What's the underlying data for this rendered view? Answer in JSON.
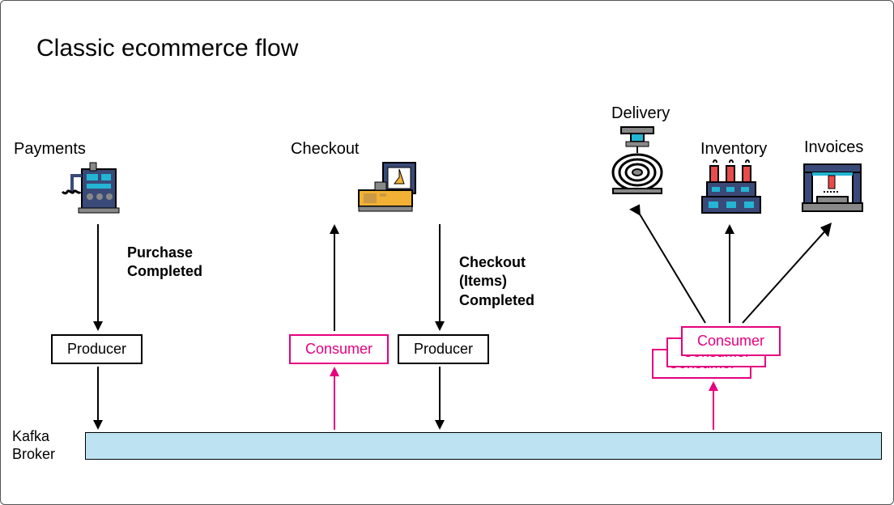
{
  "title": "Classic ecommerce flow",
  "sections": {
    "payments": "Payments",
    "checkout": "Checkout",
    "delivery": "Delivery",
    "inventory": "Inventory",
    "invoices": "Invoices"
  },
  "events": {
    "purchase_completed_l1": "Purchase",
    "purchase_completed_l2": "Completed",
    "checkout_completed_l1": "Checkout",
    "checkout_completed_l2": "(Items)",
    "checkout_completed_l3": "Completed"
  },
  "boxes": {
    "producer": "Producer",
    "consumer": "Consumer"
  },
  "kafka_label_l1": "Kafka",
  "kafka_label_l2": "Broker"
}
